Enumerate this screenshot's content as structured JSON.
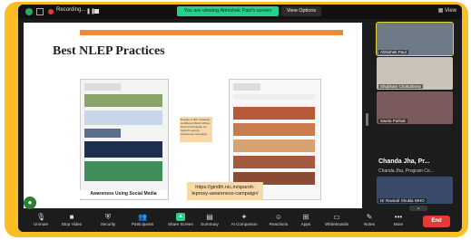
{
  "topbar": {
    "recording_label": "Recording...",
    "share_banner": "You are viewing Abhishek Paul's screen",
    "view_options": "View Options",
    "view_label": "View"
  },
  "slide": {
    "title": "Best NLEP Practices",
    "caption": "Awareness Using Social Media",
    "note": "Display of IEC materials at different Block Offices Gram Panchayats via Sparsh Leprosy Awareness Campaign",
    "url": "https://giridih.nic.in/sparsh-leprosy-awareness-campaign/"
  },
  "participants": [
    {
      "name": "Abhishek Paul"
    },
    {
      "name": "Shubham Chakraborty"
    },
    {
      "name": "Sweta Pathak"
    },
    {
      "name": "Chanda Jha, Pr..."
    },
    {
      "name": "Dr Ravindr Shukla WHO"
    }
  ],
  "sidebar": {
    "big_name": "Chanda Jha, Pr...",
    "sub_name": "Chanda Jha, Program Co..."
  },
  "toolbar": {
    "items": [
      {
        "label": "Unmute"
      },
      {
        "label": "Stop Video"
      },
      {
        "label": "Security"
      },
      {
        "label": "Participants",
        "count": "36"
      },
      {
        "label": "Share Screen"
      },
      {
        "label": "Summary"
      },
      {
        "label": "AI Companion"
      },
      {
        "label": "Reactions"
      },
      {
        "label": "Apps"
      },
      {
        "label": "Whiteboards"
      },
      {
        "label": "Notes"
      },
      {
        "label": "More"
      }
    ],
    "end": "End"
  },
  "colors": {
    "accent": "#fbbd24",
    "share_green": "#23d18b",
    "end_red": "#e53935",
    "slide_bar": "#ee8a3a"
  }
}
